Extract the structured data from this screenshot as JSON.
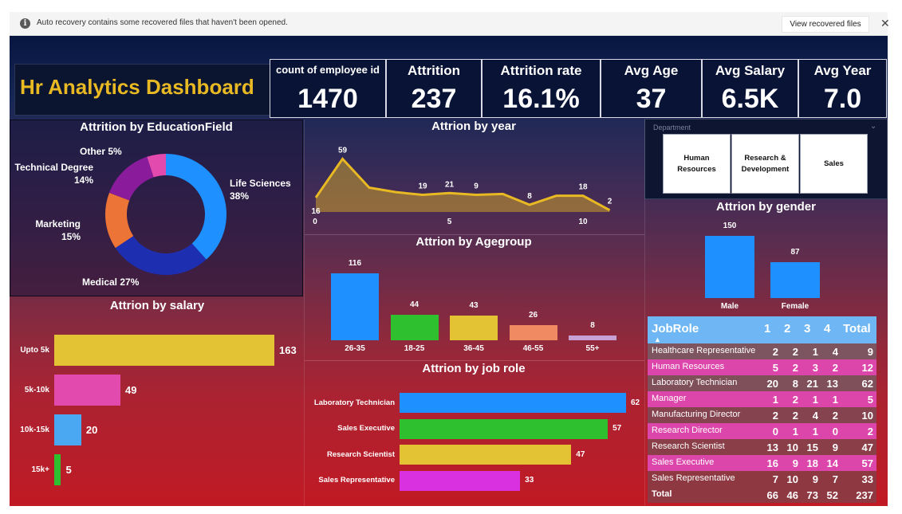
{
  "notification": {
    "message": "Auto recovery contains some recovered files that haven't been opened.",
    "button_label": "View recovered files",
    "close_glyph": "✕",
    "info_glyph": "i",
    "info_icon": "info-icon"
  },
  "dashboard": {
    "title": "Hr Analytics Dashboard",
    "kpis": [
      {
        "label": "count of employee id",
        "value": "1470"
      },
      {
        "label": "Attrition",
        "value": "237"
      },
      {
        "label": "Attrition rate",
        "value": "16.1%"
      },
      {
        "label": "Avg Age",
        "value": "37"
      },
      {
        "label": "Avg Salary",
        "value": "6.5K"
      },
      {
        "label": "Avg Year",
        "value": "7.0"
      }
    ],
    "slicer": {
      "header": "Department",
      "options": [
        "Human Resources",
        "Research & Development",
        "Sales"
      ]
    }
  },
  "colors": {
    "accent_gold": "#e8b923",
    "blue": "#1e90ff",
    "navy": "#1e2eb0",
    "green": "#2ec02e",
    "yellow": "#e3c234",
    "pink": "#e24aad",
    "purple": "#8a1c9c",
    "orange": "#ec7436",
    "violet": "#d930e0",
    "light_blue": "#4aa7f2",
    "salmon": "#f08a62",
    "lavender": "#c7a1d6"
  },
  "chart_data": [
    {
      "type": "pie",
      "title": "Attrition by EducationField",
      "categories": [
        "Life Sciences",
        "Medical",
        "Marketing",
        "Technical Degree",
        "Other"
      ],
      "values": [
        38,
        27,
        15,
        14,
        5
      ],
      "labels": [
        "38%",
        "27%",
        "15%",
        "14%",
        "5%"
      ],
      "colors": [
        "#1e90ff",
        "#1e2eb0",
        "#ec7436",
        "#8a1c9c",
        "#e24aad"
      ]
    },
    {
      "type": "area",
      "title": "Attrion by year",
      "x": [
        0,
        1,
        2,
        3,
        4,
        5,
        6,
        7,
        8,
        9,
        10,
        11
      ],
      "values": [
        16,
        59,
        27,
        22,
        19,
        21,
        19,
        20,
        8,
        18,
        18,
        2
      ],
      "data_labels": [
        {
          "i": 0,
          "text": "16"
        },
        {
          "i": 1,
          "text": "59"
        },
        {
          "i": 4,
          "text": "19"
        },
        {
          "i": 5,
          "text": "21"
        },
        {
          "i": 6,
          "text": "9"
        },
        {
          "i": 8,
          "text": "8"
        },
        {
          "i": 10,
          "text": "18"
        },
        {
          "i": 11,
          "text": "2"
        }
      ],
      "xticks": [
        "0",
        "5",
        "10"
      ],
      "color": "#e8b923"
    },
    {
      "type": "bar",
      "title": "Attrion by Agegroup",
      "categories": [
        "26-35",
        "18-25",
        "36-45",
        "46-55",
        "55+"
      ],
      "values": [
        116,
        44,
        43,
        26,
        8
      ],
      "colors": [
        "#1e90ff",
        "#2ec02e",
        "#e3c234",
        "#f08a62",
        "#c7a1d6"
      ]
    },
    {
      "type": "bar",
      "orientation": "horizontal",
      "title": "Attrion by salary",
      "categories": [
        "Upto 5k",
        "5k-10k",
        "10k-15k",
        "15k+"
      ],
      "values": [
        163,
        49,
        20,
        5
      ],
      "colors": [
        "#e3c234",
        "#e24aad",
        "#4aa7f2",
        "#2ec02e"
      ]
    },
    {
      "type": "bar",
      "orientation": "horizontal",
      "title": "Attrion by job role",
      "categories": [
        "Laboratory Technician",
        "Sales Executive",
        "Research Scientist",
        "Sales Representative"
      ],
      "values": [
        62,
        57,
        47,
        33
      ],
      "colors": [
        "#1e90ff",
        "#2ec02e",
        "#e3c234",
        "#d930e0"
      ]
    },
    {
      "type": "bar",
      "title": "Attrion by gender",
      "categories": [
        "Male",
        "Female"
      ],
      "values": [
        150,
        87
      ],
      "colors": [
        "#1e90ff",
        "#1e90ff"
      ]
    },
    {
      "type": "table",
      "columns": [
        "JobRole",
        "1",
        "2",
        "3",
        "4",
        "Total"
      ],
      "rows": [
        {
          "name": "Healthcare Representative",
          "cells": [
            "2",
            "2",
            "1",
            "4",
            "9"
          ],
          "bg": "#7c5560"
        },
        {
          "name": "Human Resources",
          "cells": [
            "5",
            "2",
            "3",
            "2",
            "12"
          ],
          "bg": "#dc45a9"
        },
        {
          "name": "Laboratory Technician",
          "cells": [
            "20",
            "8",
            "21",
            "13",
            "62"
          ],
          "bg": "#7f4f5a"
        },
        {
          "name": "Manager",
          "cells": [
            "1",
            "2",
            "1",
            "1",
            "5"
          ],
          "bg": "#dc45a9"
        },
        {
          "name": "Manufacturing Director",
          "cells": [
            "2",
            "2",
            "4",
            "2",
            "10"
          ],
          "bg": "#85434f"
        },
        {
          "name": "Research Director",
          "cells": [
            "0",
            "1",
            "1",
            "0",
            "2"
          ],
          "bg": "#dc45a9"
        },
        {
          "name": "Research Scientist",
          "cells": [
            "13",
            "10",
            "15",
            "9",
            "47"
          ],
          "bg": "#8a3e48"
        },
        {
          "name": "Sales Executive",
          "cells": [
            "16",
            "9",
            "18",
            "14",
            "57"
          ],
          "bg": "#dc45a9"
        },
        {
          "name": "Sales Representative",
          "cells": [
            "7",
            "10",
            "9",
            "7",
            "33"
          ],
          "bg": "#8e3942"
        }
      ],
      "total": {
        "name": "Total",
        "cells": [
          "66",
          "46",
          "73",
          "52",
          "237"
        ],
        "bg": "#8e3942"
      }
    }
  ]
}
